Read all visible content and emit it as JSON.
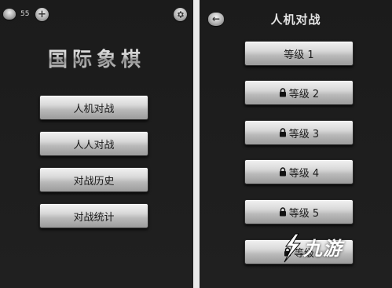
{
  "main_menu": {
    "coin_icon": "coin-icon",
    "coin_count": "55",
    "add_coins_symbol": "+",
    "settings_icon": "gear-icon",
    "title": "国际象棋",
    "buttons": [
      "人机对战",
      "人人对战",
      "对战历史",
      "对战统计"
    ]
  },
  "level_select": {
    "back_icon": "back-arrow-icon",
    "back_symbol": "←",
    "title": "人机对战",
    "levels": [
      {
        "label": "等级 1",
        "locked": false
      },
      {
        "label": "等级 2",
        "locked": true
      },
      {
        "label": "等级 3",
        "locked": true
      },
      {
        "label": "等级 4",
        "locked": true
      },
      {
        "label": "等级 5",
        "locked": true
      },
      {
        "label": "等级",
        "locked": true
      }
    ]
  },
  "watermark": {
    "text": "九游"
  },
  "colors": {
    "screen_background": "#1b1b1b",
    "page_background": "#e9e9e9",
    "button_light": "#f2f2f2",
    "button_dark": "#9b9b9b",
    "button_text": "#1c1c1c"
  }
}
